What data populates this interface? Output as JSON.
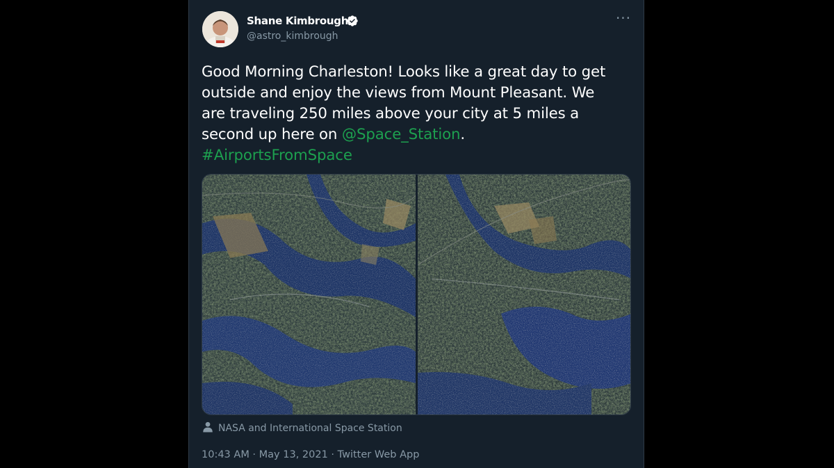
{
  "tweet": {
    "author_name": "Shane Kimbrough",
    "author_handle": "@astro_kimbrough",
    "verified_icon": "verified-badge-icon",
    "more_icon": "more-options-icon",
    "text_lines": [
      "Good Morning Charleston! Looks like a great day to get",
      "outside and enjoy the views from Mount Pleasant. We",
      "are traveling 250 miles above your city at 5 miles a"
    ],
    "text_line4_prefix": "second up here on ",
    "mention": "@Space_Station",
    "text_line4_suffix": ".",
    "hashtag": "#AirportsFromSpace",
    "media_credit": "NASA and International Space Station",
    "timestamp": "10:43 AM · May 13, 2021 · Twitter Web App"
  },
  "colors": {
    "background": "#000000",
    "card": "#15202b",
    "link": "#1da04f",
    "secondary_text": "#8899a6",
    "verified": "#ffffff"
  }
}
